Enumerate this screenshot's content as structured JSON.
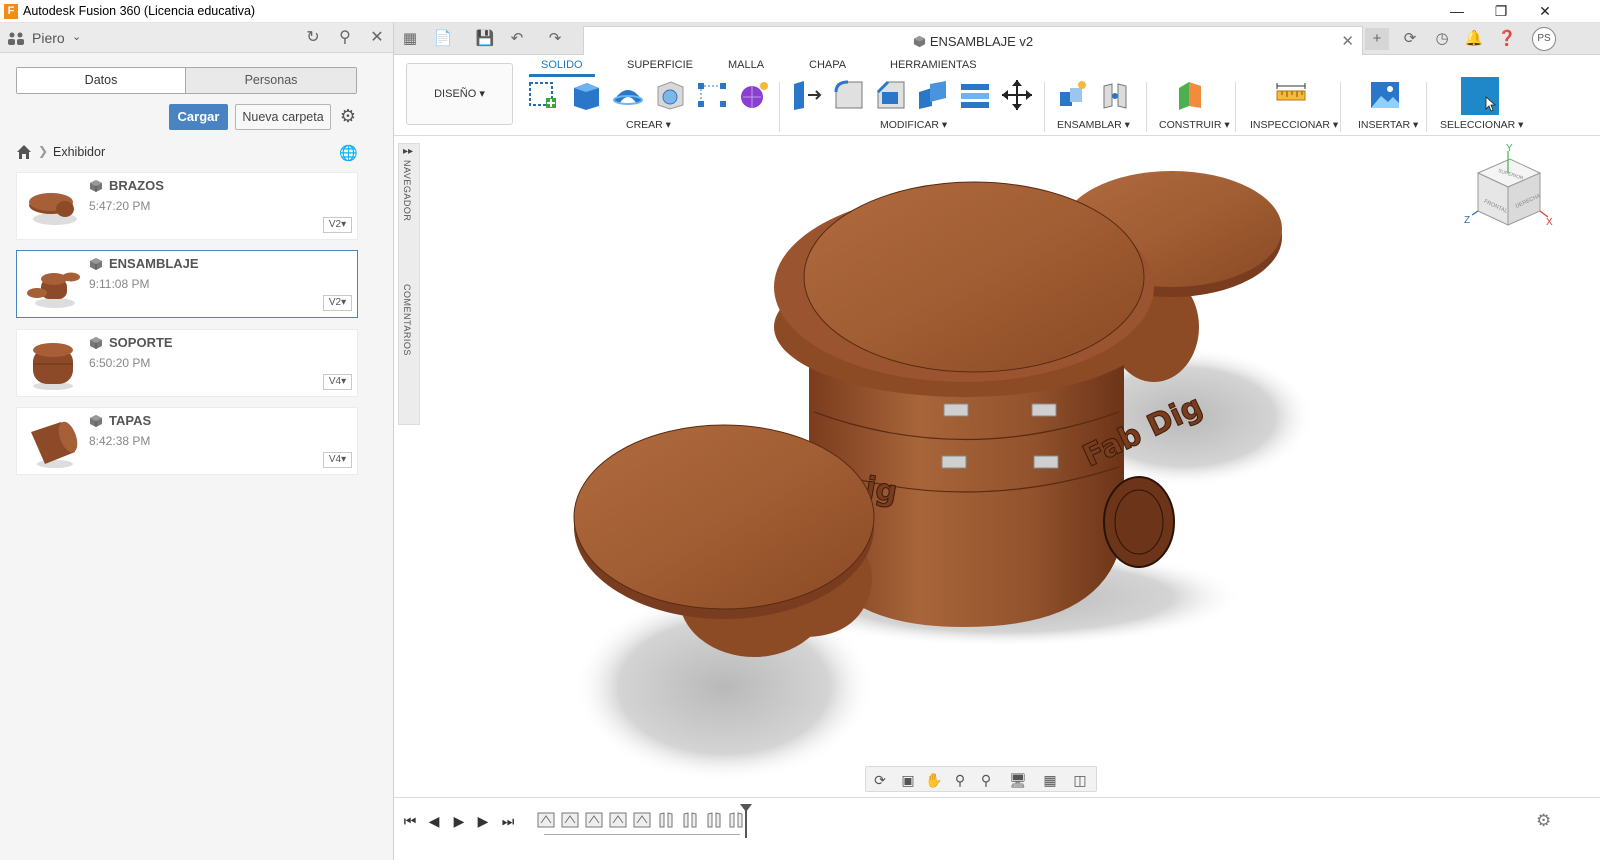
{
  "window": {
    "title": "Autodesk Fusion 360 (Licencia educativa)",
    "logo_letter": "F",
    "buttons": [
      "minimize",
      "restore",
      "close"
    ]
  },
  "data_panel": {
    "user": "Piero",
    "tabs": [
      "Datos",
      "Personas"
    ],
    "active_tab": "Datos",
    "upload_button": "Cargar",
    "new_folder_button": "Nueva carpeta",
    "breadcrumb": {
      "current": "Exhibidor"
    },
    "files": [
      {
        "name": "BRAZOS",
        "time": "5:47:20 PM",
        "version": "V2▾",
        "selected": false
      },
      {
        "name": "ENSAMBLAJE",
        "time": "9:11:08 PM",
        "version": "V2▾",
        "selected": true
      },
      {
        "name": "SOPORTE",
        "time": "6:50:20 PM",
        "version": "V4▾",
        "selected": false
      },
      {
        "name": "TAPAS",
        "time": "8:42:38 PM",
        "version": "V4▾",
        "selected": false
      }
    ]
  },
  "doc_tab": {
    "title": "ENSAMBLAJE v2",
    "avatar": "PS"
  },
  "ribbon": {
    "workspace": "DISEÑO ▾",
    "tabs": [
      "SOLIDO",
      "SUPERFICIE",
      "MALLA",
      "CHAPA",
      "HERRAMIENTAS"
    ],
    "active_tab": "SOLIDO",
    "groups": [
      "CREAR ▾",
      "MODIFICAR ▾",
      "ENSAMBLAR ▾",
      "CONSTRUIR ▾",
      "INSPECCIONAR ▾",
      "INSERTAR ▾",
      "SELECCIONAR ▾"
    ]
  },
  "browser_strip": {
    "navigator": "NAVEGADOR",
    "comments": "COMENTARIOS"
  },
  "viewcube": {
    "x_label": "X",
    "y_label": "Y",
    "z_label": "Z",
    "faces": [
      "SUPERIOR",
      "FRONTAL",
      "DERECHA"
    ]
  },
  "model": {
    "engraving": "Fab Dig",
    "engraving_left": "ig"
  },
  "colors": {
    "accent": "#1f7ac2",
    "upload_btn": "#4a83c1",
    "wood": "#9a5530",
    "select_swatch": "#1e88c9"
  }
}
